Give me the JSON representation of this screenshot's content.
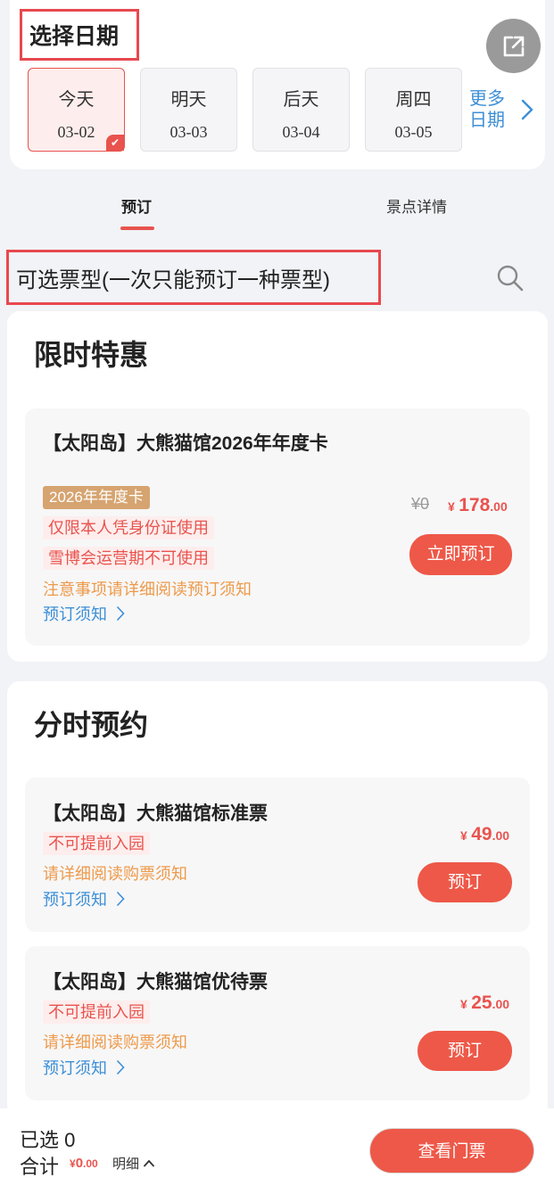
{
  "date_picker": {
    "title": "选择日期",
    "dates": [
      {
        "label": "今天",
        "date": "03-02"
      },
      {
        "label": "明天",
        "date": "03-03"
      },
      {
        "label": "后天",
        "date": "03-04"
      },
      {
        "label": "周四",
        "date": "03-05"
      }
    ],
    "selected_index": 0,
    "more_line1": "更多",
    "more_line2": "日期"
  },
  "tabs": [
    {
      "label": "预订"
    },
    {
      "label": "景点详情"
    }
  ],
  "ticket_type_title": "可选票型(一次只能预订一种票型)",
  "sections": [
    {
      "title": "限时特惠",
      "tickets": [
        {
          "name": "【太阳岛】大熊猫馆2026年年度卡",
          "tag_gold": "2026年年度卡",
          "tags_red": [
            "仅限本人凭身份证使用",
            "雪博会运营期不可使用"
          ],
          "notice": "注意事项请详细阅读预订须知",
          "link": "预订须知",
          "original_price": "¥0",
          "price_symbol": "¥",
          "price_int": "178",
          "price_dec": ".00",
          "button": "立即预订"
        }
      ]
    },
    {
      "title": "分时预约",
      "tickets": [
        {
          "name": "【太阳岛】大熊猫馆标准票",
          "tags_red": [
            "不可提前入园"
          ],
          "notice": "请详细阅读购票须知",
          "link": "预订须知",
          "price_symbol": "¥",
          "price_int": "49",
          "price_dec": ".00",
          "button": "预订"
        },
        {
          "name": "【太阳岛】大熊猫馆优待票",
          "tags_red": [
            "不可提前入园"
          ],
          "notice": "请详细阅读购票须知",
          "link": "预订须知",
          "price_symbol": "¥",
          "price_int": "25",
          "price_dec": ".00",
          "button": "预订"
        }
      ]
    }
  ],
  "bottom_bar": {
    "selected_label": "已选",
    "selected_count": "0",
    "total_label": "合计",
    "total_symbol": "¥",
    "total_int": "0",
    "total_dec": ".00",
    "detail_label": "明细",
    "view_button": "查看门票"
  },
  "colors": {
    "accent": "#ee5848",
    "link": "#3d8fd6",
    "notice": "#ee9a4a",
    "gold_tag": "#d6a470"
  },
  "icons": [
    "share-icon",
    "check-icon",
    "chevron-right-icon",
    "search-icon",
    "chevron-up-icon"
  ]
}
